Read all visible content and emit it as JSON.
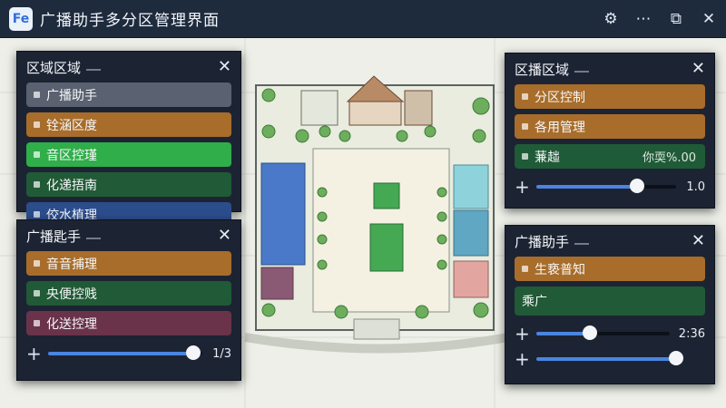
{
  "window": {
    "title": "广播助手多分区管理界面",
    "logo_text": "Fe"
  },
  "toolbar": {
    "settings_icon": "gear-icon",
    "more_icon": "more-icon",
    "external_icon": "external-link-icon",
    "close_icon": "close-icon"
  },
  "panels": {
    "top_left": {
      "title": "区域区域",
      "items": [
        {
          "label": "广播助手",
          "color": "#5a6170"
        },
        {
          "label": "铨涵区度",
          "color": "#a86d2a"
        },
        {
          "label": "音区控瑾",
          "color": "#2fae4a"
        },
        {
          "label": "化递捂南",
          "color": "#215a36"
        },
        {
          "label": "佼水植理",
          "color": "#2c4d8c"
        }
      ]
    },
    "bottom_left": {
      "title": "广播匙手",
      "items": [
        {
          "label": "音音捕理",
          "color": "#a86d2a"
        },
        {
          "label": "央便控贱",
          "color": "#215a36"
        },
        {
          "label": "化送控理",
          "color": "#6a3349"
        }
      ],
      "slider": {
        "value_text": "1/3",
        "level": 0.94
      }
    },
    "top_right": {
      "title": "区播区域",
      "items": [
        {
          "label": "分区控制",
          "color": "#a86d2a"
        },
        {
          "label": "各用管理",
          "color": "#a86d2a"
        },
        {
          "label": "蒹趉",
          "extra": "你耎%.00",
          "color": "#1f5b37"
        }
      ],
      "slider": {
        "value_text": "1.0",
        "level": 0.72
      }
    },
    "bottom_right": {
      "title": "广播助手",
      "items": [
        {
          "label": "生亵普知",
          "color": "#a86d2a"
        },
        {
          "label": "乘广",
          "color": "#215a36"
        }
      ],
      "slider1": {
        "value_text": "2:36",
        "level": 0.4
      },
      "slider2": {
        "value_text": "",
        "level": 1.0
      }
    }
  }
}
